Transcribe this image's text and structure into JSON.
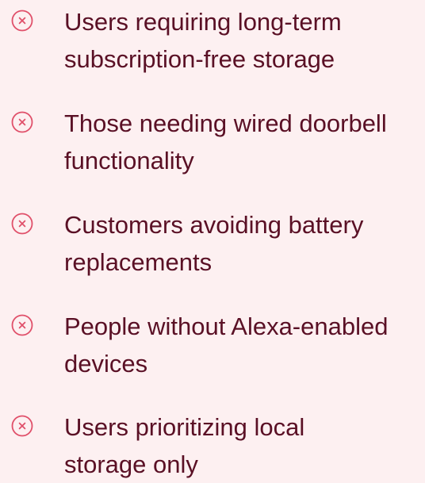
{
  "list": {
    "accent_color": "#e0506a",
    "text_color": "#5a1025",
    "background_color": "#fdf0f1",
    "icon": "circle-x-icon",
    "items": [
      {
        "line1": "Users requiring long-term",
        "line2": "subscription-free storage"
      },
      {
        "line1": "Those needing wired doorbell",
        "line2": "functionality"
      },
      {
        "line1": "Customers avoiding battery",
        "line2": "replacements"
      },
      {
        "line1": "People without Alexa-enabled",
        "line2": "devices"
      },
      {
        "line1": "Users prioritizing local",
        "line2": "storage only"
      }
    ]
  }
}
